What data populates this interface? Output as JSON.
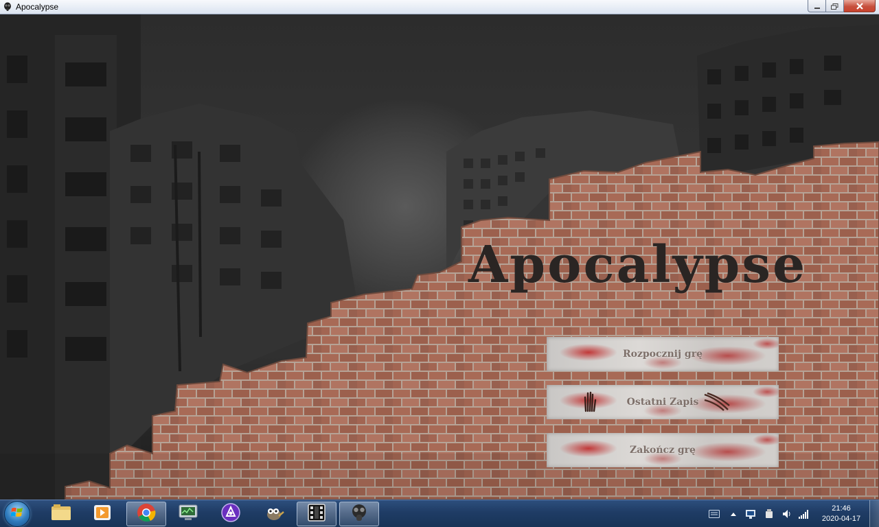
{
  "window": {
    "title": "Apocalypse",
    "icon": "gas-mask-icon",
    "controls": [
      "minimize-icon",
      "maximize-icon",
      "close-icon"
    ]
  },
  "game": {
    "title": "Apocalypse",
    "menu": {
      "start_label": "Rozpocznij grę",
      "last_save_label": "Ostatni Zapis",
      "exit_label": "Zakończ grę"
    },
    "colors": {
      "title": "#2a2523",
      "brick": "#a86a56",
      "mortar": "#b9a79c",
      "sky": "#353535",
      "paint": "#b51e1e"
    }
  },
  "taskbar": {
    "start_icon": "windows-logo-icon",
    "apps": [
      {
        "name": "file-explorer-icon"
      },
      {
        "name": "media-player-icon"
      },
      {
        "name": "chrome-icon"
      },
      {
        "name": "system-monitor-icon"
      },
      {
        "name": "purple-app-icon"
      },
      {
        "name": "gimp-icon"
      },
      {
        "name": "film-icon"
      },
      {
        "name": "gas-mask-icon"
      }
    ],
    "tray": {
      "time": "21:46",
      "date": "2020-04-17"
    }
  }
}
